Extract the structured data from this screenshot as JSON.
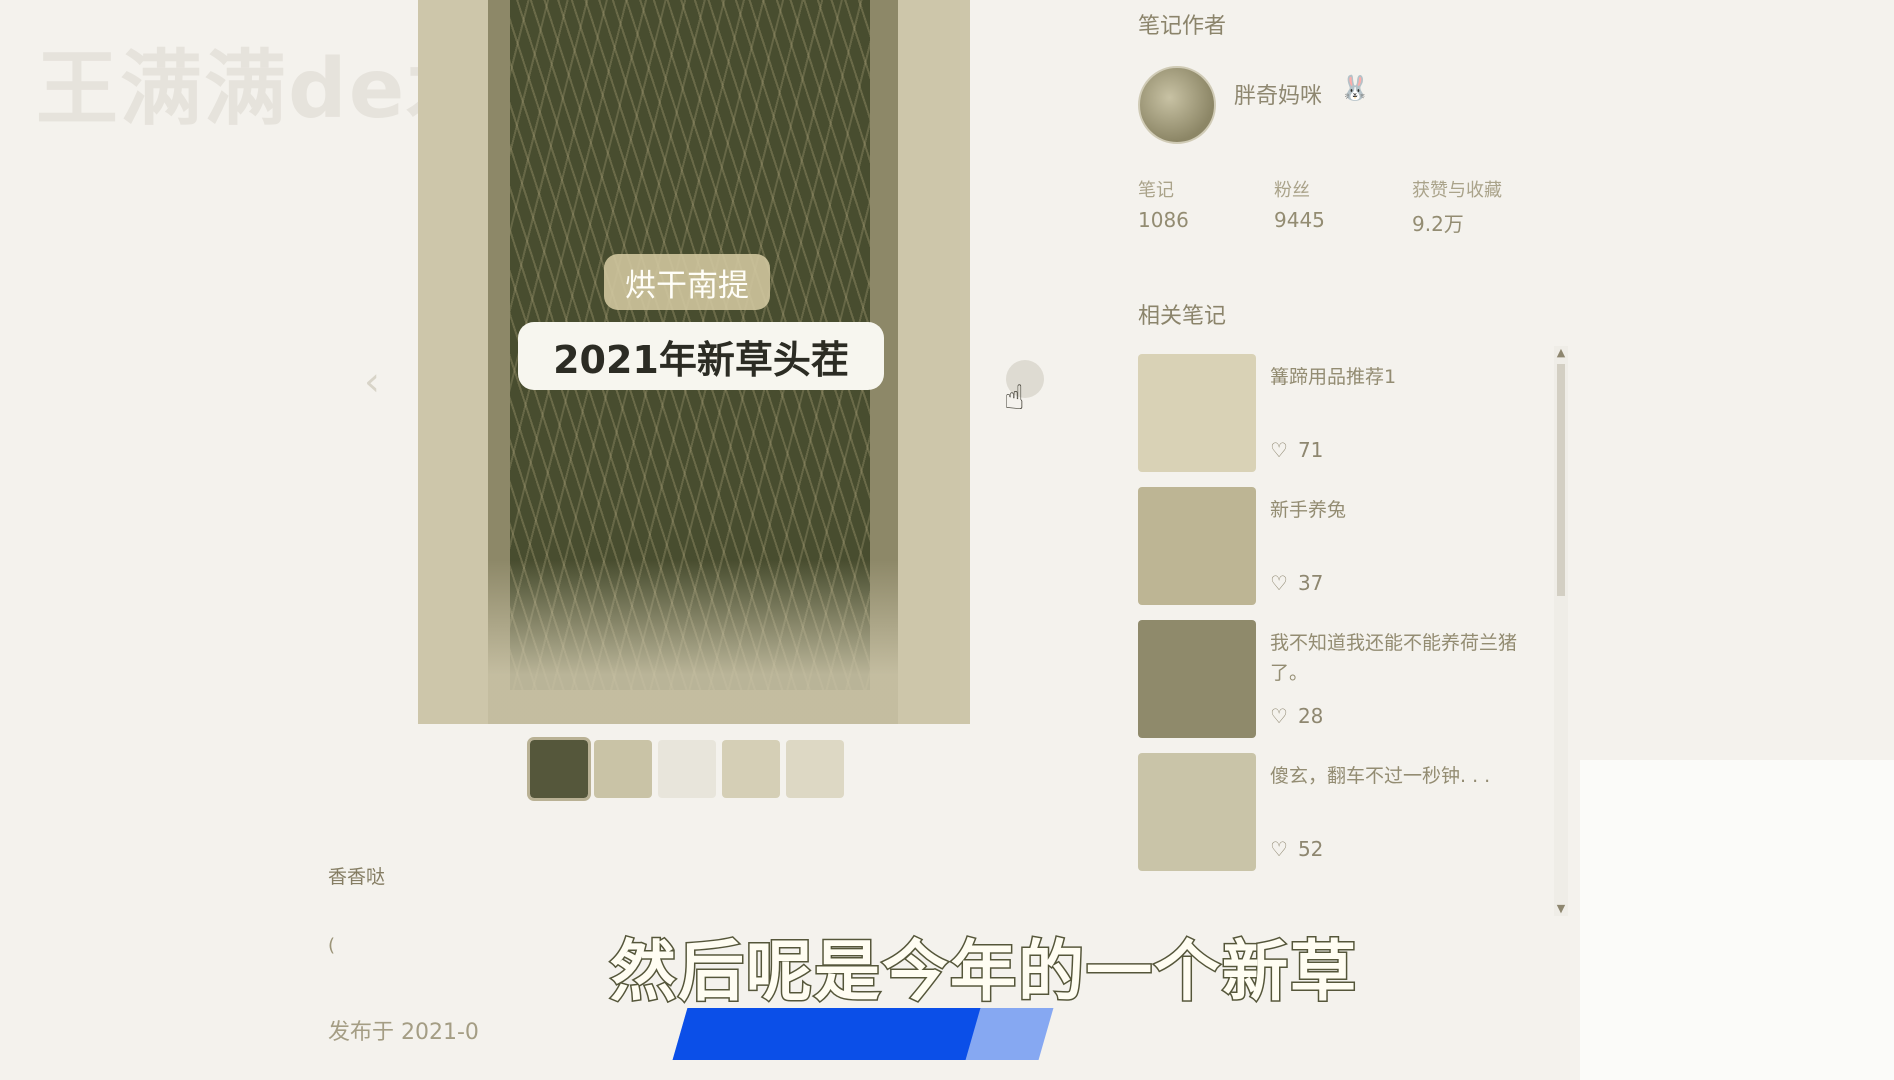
{
  "watermark": "王满满de木印",
  "post": {
    "image_tag": "烘干南提",
    "image_title": "2021年新草头茬",
    "thumbnail_count": 5,
    "caption_short": "香香哒",
    "caption_symbol": "(",
    "publish_date": "发布于 2021-0"
  },
  "nav": {
    "prev_glyph": "‹"
  },
  "subtitle": "然后呢是今年的一个新草",
  "video_progress": 0.8,
  "author_section": {
    "title": "笔记作者",
    "name": "胖奇妈咪",
    "stats": [
      {
        "label": "笔记",
        "value": "1086"
      },
      {
        "label": "粉丝",
        "value": "9445"
      },
      {
        "label": "获赞与收藏",
        "value": "9.2万"
      }
    ]
  },
  "related_section": {
    "title": "相关笔记",
    "items": [
      {
        "title": "篝蹄用品推荐1",
        "likes": "71",
        "thumb_color": "#d9d2b6"
      },
      {
        "title": "新手养兔",
        "likes": "37",
        "thumb_color": "#bdb594"
      },
      {
        "title": "我不知道我还能不能养荷兰猪了。",
        "likes": "28",
        "thumb_color": "#8f8a6b"
      },
      {
        "title": "傻玄，翻车不过一秒钟. . .",
        "likes": "52",
        "thumb_color": "#c9c4a8"
      }
    ]
  },
  "icons": {
    "heart": "heart-icon",
    "cursor": "hand-cursor-icon"
  },
  "colors": {
    "progress_fill": "#0b4fe8",
    "progress_track": "#86a8f2"
  }
}
